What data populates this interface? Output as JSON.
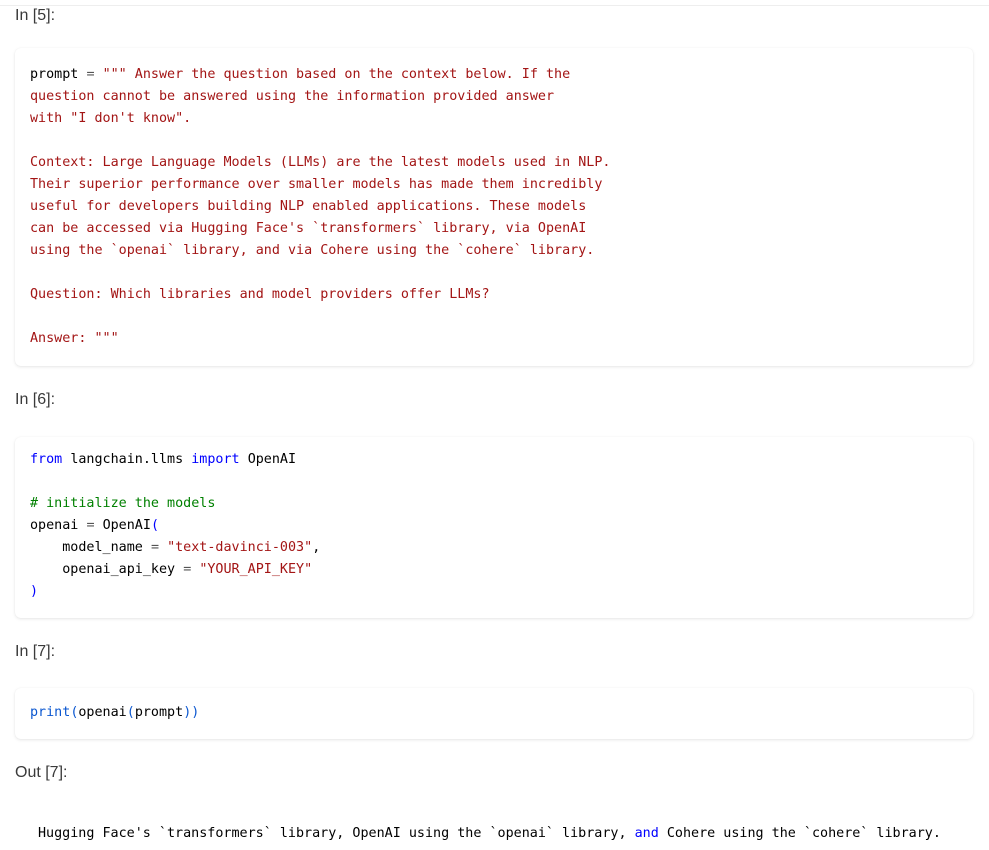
{
  "cells": {
    "c5": {
      "label": "In [5]:",
      "line1_name": "prompt",
      "line1_eq": "=",
      "line1_str": "\"\"\" Answer the question based on the context below. If the",
      "line2": "question cannot be answered using the information provided answer",
      "line3": "with \"I don't know\".",
      "ctx1": "Context: Large Language Models (LLMs) are the latest models used in NLP.",
      "ctx2": "Their superior performance over smaller models has made them incredibly",
      "ctx3": "useful for developers building NLP enabled applications. These models",
      "ctx4": "can be accessed via Hugging Face's `transformers` library, via OpenAI",
      "ctx5": "using the `openai` library, and via Cohere using the `cohere` library.",
      "question": "Question: Which libraries and model providers offer LLMs?",
      "answer": "Answer: \"\"\""
    },
    "c6": {
      "label": "In [6]:",
      "from_kw": "from",
      "module": "langchain.llms",
      "import_kw": "import",
      "cls": "OpenAI",
      "comment": "# initialize the models",
      "var": "openai",
      "eq": "=",
      "call": "OpenAI",
      "paren_open": "(",
      "arg1_name": "model_name",
      "arg1_eq": "=",
      "arg1_val": "\"text-davinci-003\"",
      "comma": ",",
      "arg2_name": "openai_api_key",
      "arg2_eq": "=",
      "arg2_val": "\"YOUR_API_KEY\"",
      "paren_close": ")"
    },
    "c7": {
      "label": "In [7]:",
      "print_fn": "print",
      "po": "(",
      "inner": "openai",
      "po2": "(",
      "arg": "prompt",
      "pc": "))"
    },
    "out7": {
      "label": "Out [7]:",
      "part1": "Hugging Face's `transformers` library, OpenAI using the `openai` library, ",
      "and_kw": "and",
      "part2": " Cohere using the `cohere` library."
    }
  }
}
